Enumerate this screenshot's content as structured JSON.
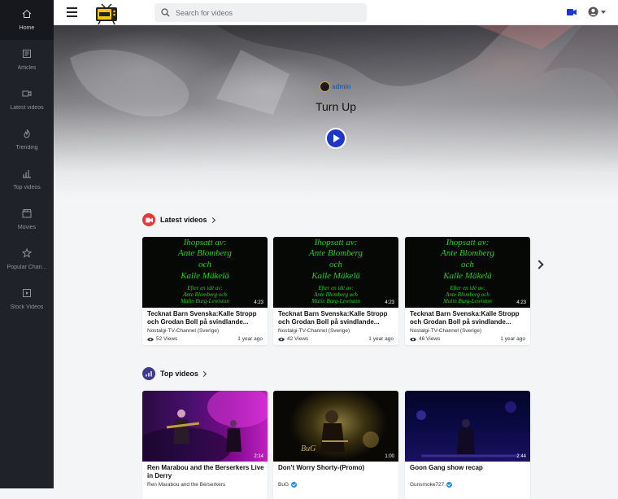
{
  "sidebar": {
    "items": [
      {
        "label": "Home",
        "icon": "home-icon"
      },
      {
        "label": "Articles",
        "icon": "articles-icon"
      },
      {
        "label": "Latest videos",
        "icon": "video-camera-icon"
      },
      {
        "label": "Trending",
        "icon": "flame-icon"
      },
      {
        "label": "Top videos",
        "icon": "bar-chart-icon"
      },
      {
        "label": "Movies",
        "icon": "clapperboard-icon"
      },
      {
        "label": "Popular Chan...",
        "icon": "star-icon"
      },
      {
        "label": "Stock Videos",
        "icon": "play-square-icon"
      }
    ]
  },
  "header": {
    "search_placeholder": "Search for videos"
  },
  "hero": {
    "author": "admin",
    "title": "Turn Up"
  },
  "colors": {
    "accent_blue": "#1e37c8",
    "link_blue": "#1565c0",
    "latest_red": "#e53935",
    "top_purple": "#3f3a8a",
    "sidebar_bg": "#1f2229"
  },
  "latest": {
    "heading": "Latest videos",
    "thumb_lines": [
      "Ihopsatt av:",
      "Ante Blomberg",
      "och",
      "Kalle Mäkelä",
      "Efter en idé av:",
      "Ante Blomberg och",
      "Malin Burg-Lewiston"
    ],
    "cards": [
      {
        "title": "Tecknat Barn Svenska:Kalle Stropp och Grodan Boll på svindlande...",
        "channel": "Nostalgi-TV-Channel (Sverige)",
        "views": "52 Views",
        "ago": "1 year ago",
        "duration": "4:23"
      },
      {
        "title": "Tecknat Barn Svenska:Kalle Stropp och Grodan Boll på svindlande...",
        "channel": "Nostalgi-TV-Channel (Sverige)",
        "views": "42 Views",
        "ago": "1 year ago",
        "duration": "4:23"
      },
      {
        "title": "Tecknat Barn Svenska:Kalle Stropp och Grodan Boll på svindlande...",
        "channel": "Nostalgi-TV-Channel (Sverige)",
        "views": "46 Views",
        "ago": "1 year ago",
        "duration": "4:23"
      }
    ]
  },
  "top": {
    "heading": "Top videos",
    "cards": [
      {
        "title": "Ren Marabou and the Berserkers Live in Derry",
        "channel": "Ren Marabou and the Berserkers",
        "duration": "2:14"
      },
      {
        "title": "Don't Worry Shorty-(Promo)",
        "channel": "BuG",
        "duration": "1:00",
        "thumb_text": "BuG"
      },
      {
        "title": "Goon Gang show recap",
        "channel": "Gunsmoke727",
        "duration": "2:44"
      }
    ]
  }
}
